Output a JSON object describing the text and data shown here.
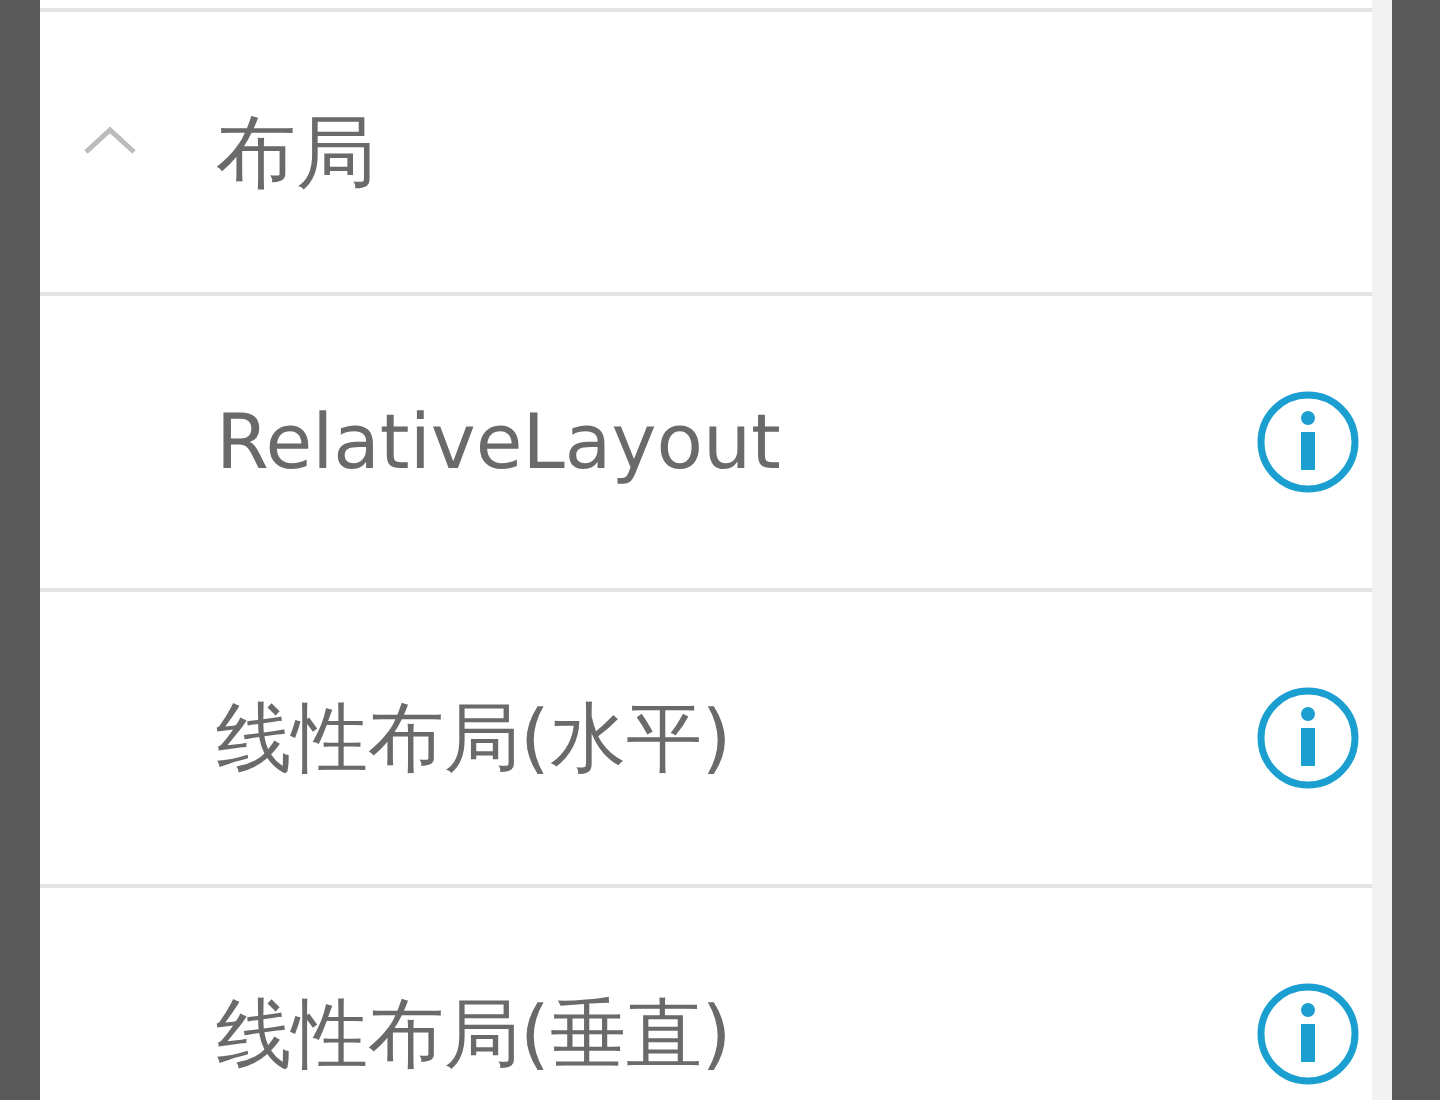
{
  "section": {
    "title": "布局",
    "expanded": true
  },
  "items": [
    {
      "label": "RelativeLayout"
    },
    {
      "label": "线性布局(水平)"
    },
    {
      "label": "线性布局(垂直)"
    }
  ]
}
